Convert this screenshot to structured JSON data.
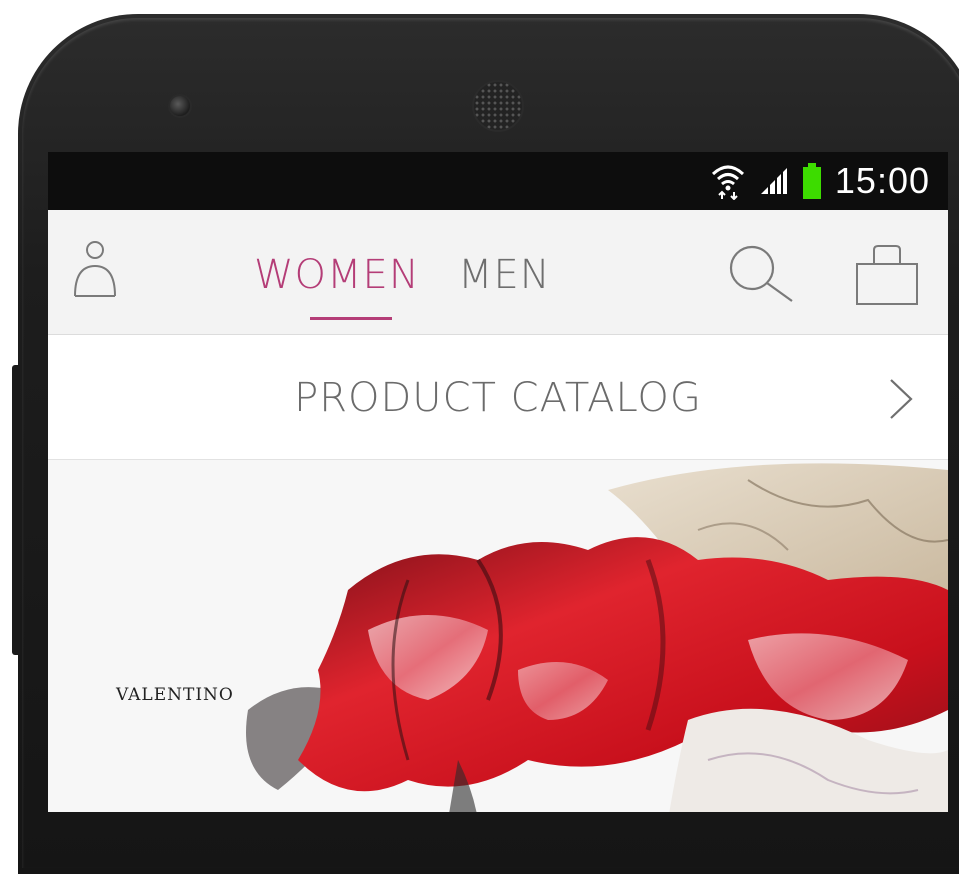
{
  "status_bar": {
    "time": "15:00",
    "icons": [
      "wifi-icon",
      "signal-icon",
      "battery-icon"
    ],
    "battery_color": "#3ddc00"
  },
  "nav": {
    "icons": [
      "account-icon",
      "search-icon",
      "shopping-bag-icon"
    ],
    "tabs": [
      {
        "label": "WOMEN",
        "selected": true
      },
      {
        "label": "MEN",
        "selected": false
      }
    ],
    "accent_color": "#b43d77"
  },
  "catalog": {
    "label": "PRODUCT CATALOG",
    "icon": "chevron-right-icon"
  },
  "hero": {
    "brand": "VALENTINO"
  }
}
